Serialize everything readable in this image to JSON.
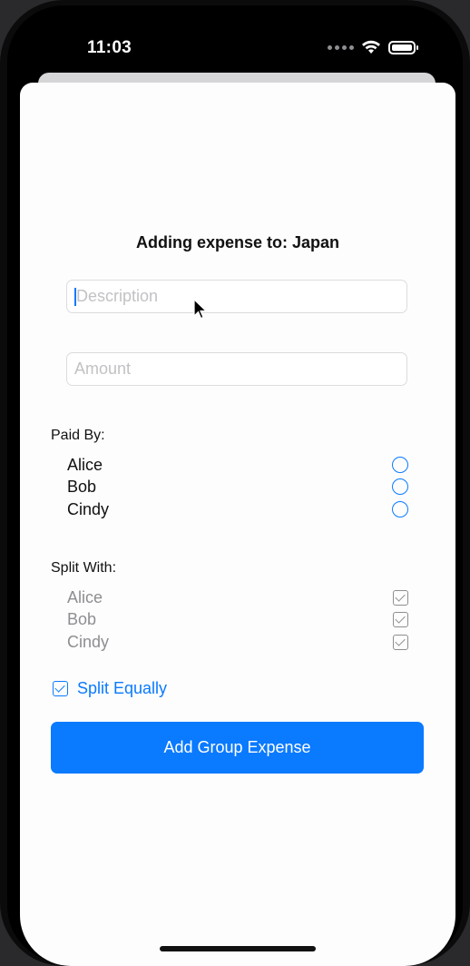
{
  "status_bar": {
    "time": "11:03"
  },
  "sheet": {
    "title": "Adding expense to: Japan",
    "description": {
      "value": "",
      "placeholder": "Description"
    },
    "amount": {
      "value": "",
      "placeholder": "Amount"
    },
    "paid_by": {
      "label": "Paid By:",
      "options": [
        {
          "name": "Alice",
          "selected": false
        },
        {
          "name": "Bob",
          "selected": false
        },
        {
          "name": "Cindy",
          "selected": false
        }
      ]
    },
    "split_with": {
      "label": "Split With:",
      "options": [
        {
          "name": "Alice",
          "checked": true
        },
        {
          "name": "Bob",
          "checked": true
        },
        {
          "name": "Cindy",
          "checked": true
        }
      ]
    },
    "split_equally": {
      "label": "Split Equally",
      "checked": true
    },
    "primary_button": "Add Group Expense"
  },
  "colors": {
    "accent": "#0a7aff",
    "muted": "#8e8e93"
  }
}
